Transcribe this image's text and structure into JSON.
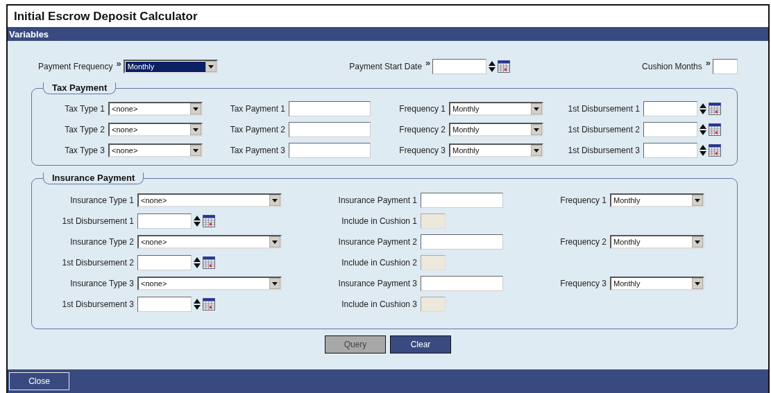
{
  "window": {
    "title": "Initial Escrow Deposit Calculator"
  },
  "header": {
    "title": "Variables"
  },
  "top_fields": [
    {
      "kind": "dropdown",
      "label": "Payment Frequency",
      "marker": "»",
      "value": "Monthly",
      "highlighted": true
    },
    {
      "kind": "date",
      "label": "Payment Start Date",
      "marker": "»"
    },
    {
      "kind": "text",
      "label": "Cushion Months",
      "marker": "»"
    }
  ],
  "tax_payment": {
    "title": "Tax Payment",
    "rows": [
      {
        "type_label": "Tax Type 1",
        "type_value": "<none>",
        "payment_label": "Tax Payment 1",
        "frequency_label": "Frequency 1",
        "frequency_value": "Monthly",
        "disbursement_label": "1st Disbursement 1"
      },
      {
        "type_label": "Tax Type 2",
        "type_value": "<none>",
        "payment_label": "Tax Payment 2",
        "frequency_label": "Frequency 2",
        "frequency_value": "Monthly",
        "disbursement_label": "1st Disbursement 2"
      },
      {
        "type_label": "Tax Type 3",
        "type_value": "<none>",
        "payment_label": "Tax Payment 3",
        "frequency_label": "Frequency 3",
        "frequency_value": "Monthly",
        "disbursement_label": "1st Disbursement 3"
      }
    ]
  },
  "insurance_payment": {
    "title": "Insurance Payment",
    "rows": [
      {
        "type_label": "Insurance Type 1",
        "type_value": "<none>",
        "payment_label": "Insurance Payment 1",
        "frequency_label": "Frequency 1",
        "frequency_value": "Monthly",
        "disbursement_label": "1st Disbursement 1",
        "cushion_label": "Include in Cushion 1",
        "cushion_disabled": true
      },
      {
        "type_label": "Insurance Type 2",
        "type_value": "<none>",
        "payment_label": "Insurance Payment 2",
        "frequency_label": "Frequency 2",
        "frequency_value": "Monthly",
        "disbursement_label": "1st Disbursement 2",
        "cushion_label": "Include in Cushion 2",
        "cushion_disabled": true
      },
      {
        "type_label": "Insurance Type 3",
        "type_value": "<none>",
        "payment_label": "Insurance Payment 3",
        "frequency_label": "Frequency 3",
        "frequency_value": "Monthly",
        "disbursement_label": "1st Disbursement 3",
        "cushion_label": "Include in Cushion 3",
        "cushion_disabled": true
      }
    ]
  },
  "buttons": [
    {
      "label": "Query",
      "disabled": true
    },
    {
      "label": "Clear",
      "disabled": false
    }
  ],
  "footer": {
    "close_label": "Close"
  }
}
